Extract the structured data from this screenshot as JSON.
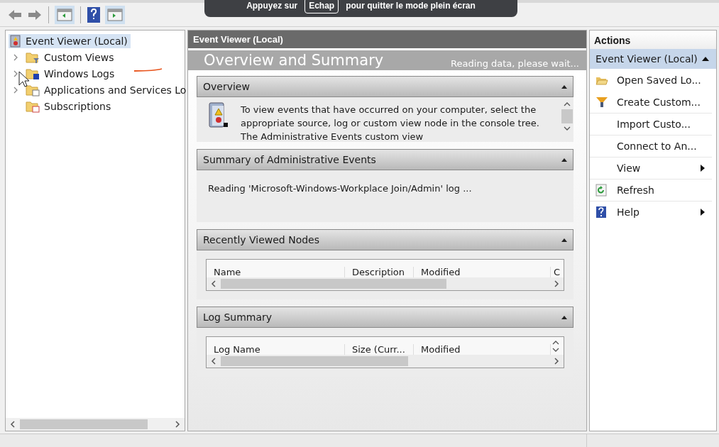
{
  "fullscreen_notice": {
    "before": "Appuyez sur",
    "key": "Echap",
    "after": "pour quitter le mode plein écran"
  },
  "tree": [
    {
      "label": "Event Viewer (Local)",
      "selected": true,
      "children": [
        {
          "label": "Custom Views",
          "selected": false
        },
        {
          "label": "Windows Logs",
          "selected": false
        },
        {
          "label": "Applications and Services Lo",
          "selected": false
        },
        {
          "label": "Subscriptions",
          "selected": false
        }
      ]
    }
  ],
  "center": {
    "title": "Event Viewer (Local)",
    "banner": {
      "title": "Overview and Summary",
      "status": "Reading data, please wait..."
    },
    "sections": [
      {
        "kind": "text",
        "title": "Overview",
        "expanded": true,
        "text": "To view events that have occurred on your computer, select the appropriate source, log or custom view node in the console tree. The Administrative Events custom view"
      },
      {
        "kind": "status",
        "title": "Summary of Administrative Events",
        "expanded": true,
        "text": "Reading 'Microsoft-Windows-Workplace Join/Admin' log ..."
      },
      {
        "kind": "table",
        "title": "Recently Viewed Nodes",
        "expanded": true,
        "columns": [
          "Name",
          "Description",
          "Modified",
          "C"
        ]
      },
      {
        "kind": "table",
        "title": "Log Summary",
        "expanded": true,
        "columns": [
          "Log Name",
          "Size (Curr...",
          "Modified"
        ]
      }
    ]
  },
  "actions": {
    "title": "Actions",
    "group": {
      "label": "Event Viewer (Local)",
      "expanded": true
    },
    "items": [
      {
        "label": "Open Saved Lo...",
        "submenu": false
      },
      {
        "label": "Create Custom...",
        "submenu": false
      },
      {
        "label": "Import Custo...",
        "submenu": false
      },
      {
        "label": "Connect to An...",
        "submenu": false
      },
      {
        "label": "View",
        "submenu": true
      },
      {
        "label": "Refresh",
        "submenu": false
      },
      {
        "label": "Help",
        "submenu": true
      }
    ]
  }
}
